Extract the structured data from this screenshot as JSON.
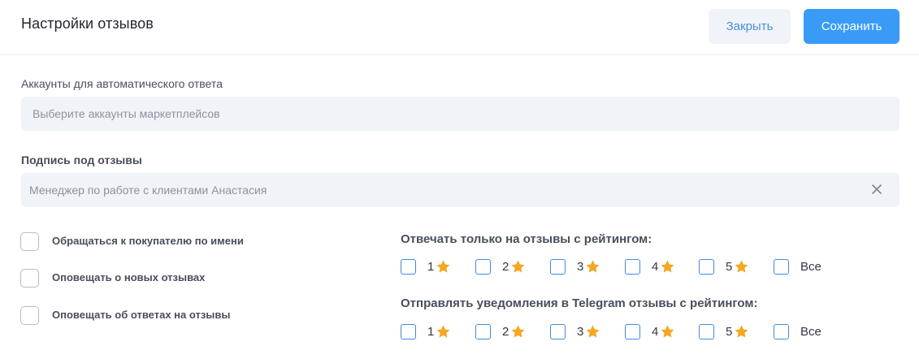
{
  "header": {
    "title": "Настройки отзывов",
    "close_label": "Закрыть",
    "save_label": "Сохранить"
  },
  "accounts": {
    "label": "Аккаунты для автоматического ответа",
    "placeholder": "Выберите аккаунты маркетплейсов"
  },
  "signature": {
    "label": "Подпись под отзывы",
    "placeholder": "Менеджер по работе с клиентами Анастасия",
    "clear_icon": "close-icon"
  },
  "options": [
    {
      "label": "Обращаться к покупателю по имени",
      "checked": false
    },
    {
      "label": "Оповещать о новых отзывах",
      "checked": false
    },
    {
      "label": "Оповещать об ответах на отзывы",
      "checked": false
    }
  ],
  "reply_rating": {
    "title": "Отвечать только на отзывы с рейтингом:",
    "items": [
      "1",
      "2",
      "3",
      "4",
      "5"
    ],
    "all_label": "Все"
  },
  "telegram_rating": {
    "title": "Отправлять уведомления в Telegram отзывы с рейтингом:",
    "items": [
      "1",
      "2",
      "3",
      "4",
      "5"
    ],
    "all_label": "Все"
  },
  "colors": {
    "accent": "#3a9bf7",
    "star": "#f5a623",
    "checkbox_border": "#3f8be0"
  },
  "icons": {
    "star": "star-icon"
  }
}
